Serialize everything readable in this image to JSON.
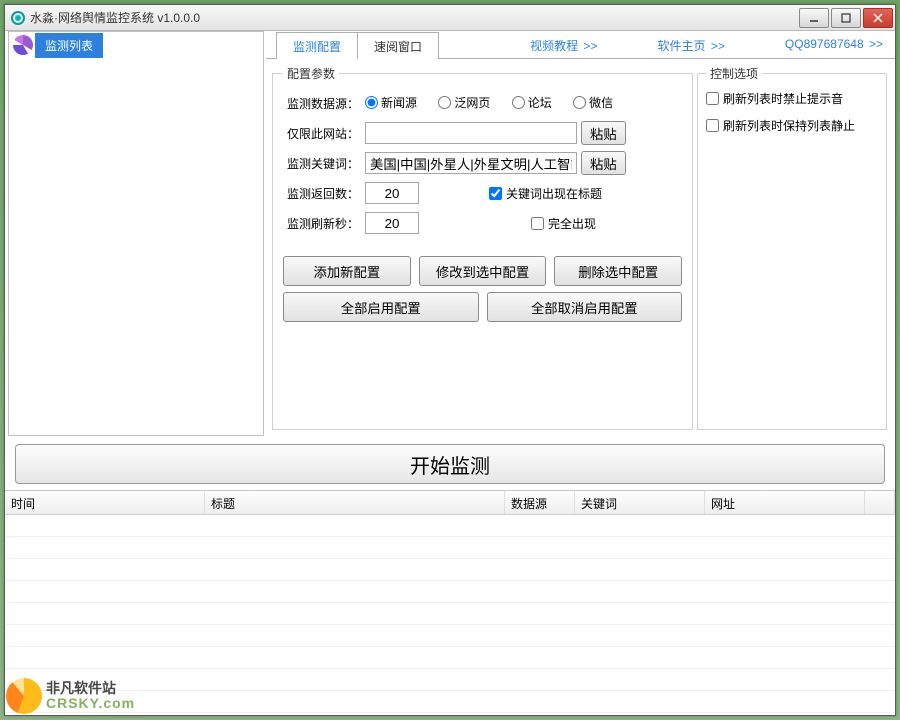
{
  "window": {
    "title": "水淼·网络舆情监控系统 v1.0.0.0"
  },
  "sidebar": {
    "tab_label": "监测列表"
  },
  "nav": {
    "tabs": [
      {
        "label": "监测配置",
        "active": true
      },
      {
        "label": "速阅窗口",
        "active": false
      }
    ],
    "links": [
      {
        "label": "视频教程",
        "suffix": ">>"
      },
      {
        "label": "软件主页",
        "suffix": ">>"
      },
      {
        "label": "QQ897687648",
        "suffix": ">>"
      }
    ]
  },
  "params": {
    "legend": "配置参数",
    "row_source": {
      "label": "监测数据源：",
      "options": [
        "新闻源",
        "泛网页",
        "论坛",
        "微信"
      ],
      "selected": 0
    },
    "row_site": {
      "label": "仅限此网站：",
      "value": "",
      "paste": "粘贴"
    },
    "row_keywords": {
      "label": "监测关键词：",
      "value": "美国|中国|外星人|外星文明|人工智能",
      "paste": "粘贴"
    },
    "row_return": {
      "label": "监测返回数：",
      "value": "20",
      "chk_in_title": {
        "checked": true,
        "label": "关键词出现在标题"
      }
    },
    "row_refresh": {
      "label": "监测刷新秒：",
      "value": "20",
      "chk_full": {
        "checked": false,
        "label": "完全出现"
      }
    },
    "buttons": {
      "add": "添加新配置",
      "modify": "修改到选中配置",
      "delete": "删除选中配置",
      "enable_all": "全部启用配置",
      "disable_all": "全部取消启用配置"
    }
  },
  "controls": {
    "legend": "控制选项",
    "opt_mute": {
      "checked": false,
      "label": "刷新列表时禁止提示音"
    },
    "opt_freeze": {
      "checked": false,
      "label": "刷新列表时保持列表静止"
    }
  },
  "start_label": "开始监测",
  "table": {
    "columns": [
      "时间",
      "标题",
      "数据源",
      "关键词",
      "网址",
      ""
    ],
    "rows": []
  },
  "watermark": {
    "cn": "非凡软件站",
    "en": "CRSKY.com"
  }
}
